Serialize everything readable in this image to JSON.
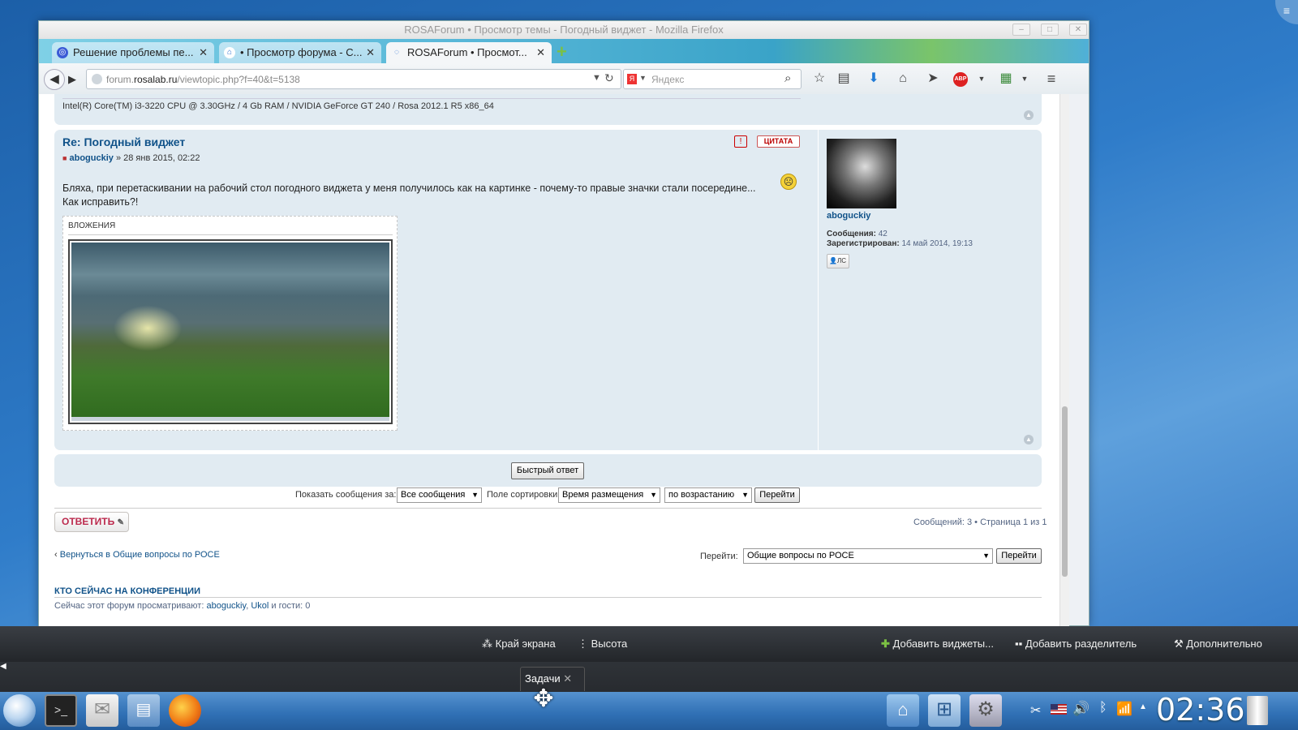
{
  "window": {
    "title": "ROSAForum • Просмотр темы - Погодный виджет - Mozilla Firefox",
    "controls": [
      "–",
      "□",
      "✕"
    ]
  },
  "tabs": [
    {
      "label": "Решение проблемы пе...",
      "icon": "rosa-icon",
      "active": false
    },
    {
      "label": "• Просмотр форума - С...",
      "icon": "home-icon",
      "active": false
    },
    {
      "label": "ROSAForum • Просмот...",
      "icon": "loading-icon",
      "active": true
    }
  ],
  "new_tab": "+",
  "address": {
    "pre": "forum.",
    "domain": "rosalab.ru",
    "path": "/viewtopic.php?f=40&t=5138"
  },
  "search": {
    "placeholder": "Яндекс",
    "engine_letter": "Я"
  },
  "toolbar": {
    "adblock": "ABP"
  },
  "prev_post": {
    "signature": "Intel(R) Core(TM) i3-3220 CPU @ 3.30GHz / 4 Gb RAM / NVIDIA GeForce GT 240 / Rosa 2012.1 R5 x86_64"
  },
  "post": {
    "title": "Re: Погодный виджет",
    "author": "aboguckiy",
    "date": "» 28 янв 2015, 02:22",
    "report_glyph": "!",
    "quote_label": "ЦИТАТА",
    "body_line1": "Бляха, при перетаскивании на рабочий стол погодного виджета у меня получилось как на картинке - почему-то правые значки стали посередине...",
    "body_line2": "Как исправить?!",
    "attachments_label": "ВЛОЖЕНИЯ"
  },
  "profile": {
    "username": "aboguckiy",
    "posts_label": "Сообщения:",
    "posts_value": "42",
    "registered_label": "Зарегистрирован:",
    "registered_value": "14 май 2014, 19:13",
    "pm_label": "ЛС"
  },
  "quick_reply": "Быстрый ответ",
  "sort": {
    "show_label": "Показать сообщения за:",
    "show_value": "Все сообщения",
    "sort_label": "Поле сортировки",
    "sort_value": "Время размещения",
    "order_value": "по возрастанию",
    "go": "Перейти"
  },
  "reply_button": "ОТВЕТИТЬ",
  "pagination": "Сообщений: 3 • Страница 1 из 1",
  "back_link": "Вернуться в Общие вопросы по РОСЕ",
  "jump": {
    "label": "Перейти:",
    "value": "Общие вопросы по РОСЕ",
    "go": "Перейти"
  },
  "online": {
    "heading": "КТО СЕЙЧАС НА КОНФЕРЕНЦИИ",
    "prefix": "Сейчас этот форум просматривают:",
    "user1": "aboguckiy",
    "sep": ",",
    "user2": "Ukol",
    "suffix": "и гости: 0"
  },
  "plasma": {
    "screen_edge": "Край экрана",
    "height": "Высота",
    "add_widgets": "Добавить виджеты...",
    "add_separator": "Добавить разделитель",
    "more": "Дополнительно"
  },
  "tasks_label": "Задачи",
  "clock": "02:36"
}
